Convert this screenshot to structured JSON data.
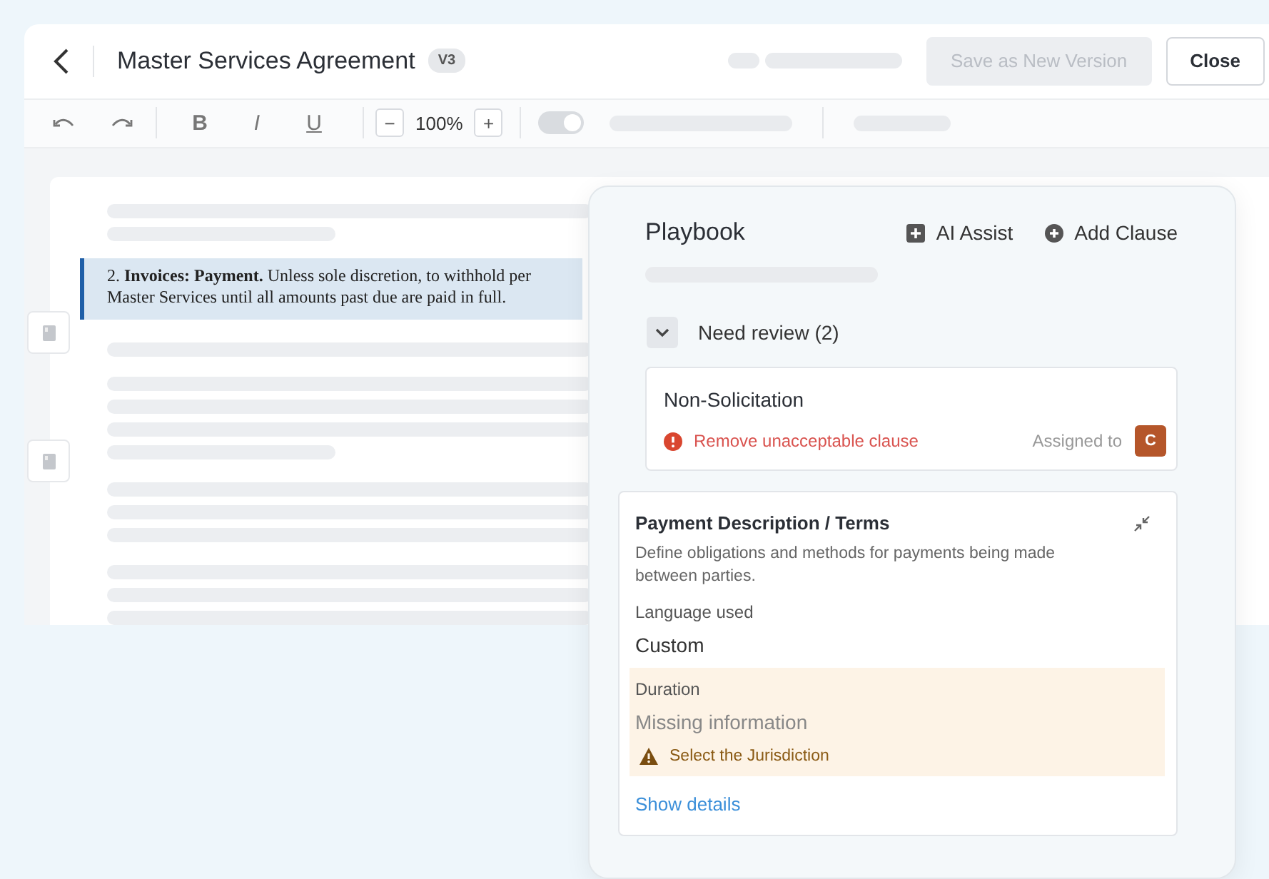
{
  "header": {
    "title": "Master Services Agreement",
    "version": "V3",
    "buttons": [
      {
        "label": "Save as New Version",
        "disabled": true
      },
      {
        "label": "Close",
        "disabled": false
      }
    ]
  },
  "toolbar": {
    "format": [
      "B",
      "I",
      "U"
    ],
    "zoom_out": "−",
    "zoom": "100%",
    "zoom_in": "+",
    "toggle_on": true
  },
  "document": {
    "highlighted_clause": [
      "2. **Invoices: Payment.** Unless sole discretion, to withhold per",
      "Master Services until all amounts past due are paid in full."
    ]
  },
  "playbook": {
    "title": "Playbook",
    "actions": [
      {
        "kind": "ai",
        "label": "AI Assist"
      },
      {
        "kind": "add",
        "label": "Add Clause"
      }
    ],
    "group": {
      "label": "Need review (2)",
      "expanded": true,
      "items": [
        {
          "kind": "issue",
          "title": "Non-Solicitation",
          "issue": "Remove unacceptable clause",
          "assigned_label": "Assigned to",
          "assignee": "C",
          "color": "#b5562a"
        },
        {
          "kind": "detail",
          "title": "Payment Description / Terms",
          "description": "Define obligations and methods for payments being made between parties.",
          "fields": [
            {
              "label": "Language used",
              "value": "Custom",
              "missing": false
            },
            {
              "label": "Duration",
              "value": "Missing information",
              "missing": true,
              "warning": "Select the Jurisdiction"
            }
          ],
          "link": "Show details"
        }
      ]
    }
  }
}
